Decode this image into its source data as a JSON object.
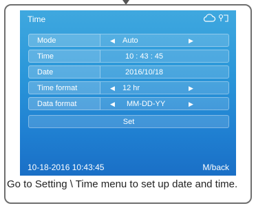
{
  "screen": {
    "title": "Time",
    "icons": [
      "cloud-icon",
      "wifi-icon"
    ],
    "rows": [
      {
        "label": "Mode",
        "value": "Auto",
        "arrows": true
      },
      {
        "label": "Time",
        "value": "10 : 43 : 45",
        "arrows": false
      },
      {
        "label": "Date",
        "value": "2016/10/18",
        "arrows": false
      },
      {
        "label": "Time format",
        "value": "12 hr",
        "arrows": true
      },
      {
        "label": "Data format",
        "value": "MM-DD-YY",
        "arrows": true
      }
    ],
    "set_label": "Set",
    "status_datetime": "10-18-2016 10:43:45",
    "back_label": "M/back",
    "arrow_left": "◀",
    "arrow_right": "▶"
  },
  "caption": "Go to Setting \\ Time menu to set up date and time.",
  "colors": {
    "screen_top": "#3fa8df",
    "screen_bottom": "#1a6fc6",
    "frame_border": "#6e6e6e"
  }
}
